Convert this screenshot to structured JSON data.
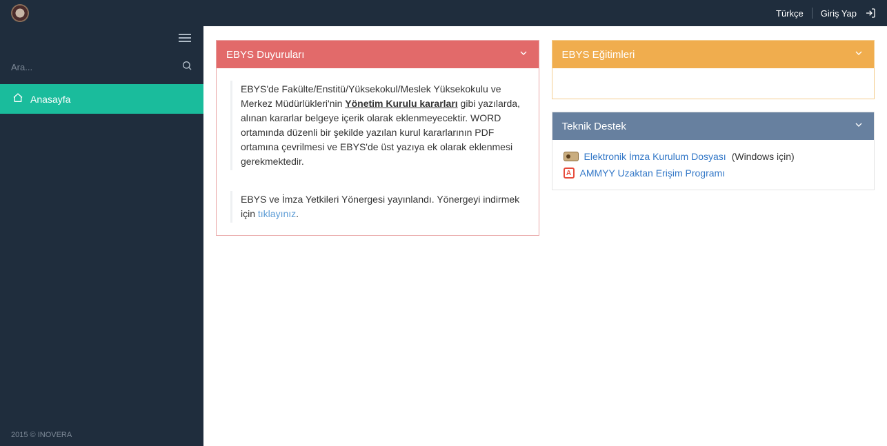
{
  "header": {
    "language": "Türkçe",
    "login": "Giriş Yap"
  },
  "sidebar": {
    "search_placeholder": "Ara...",
    "nav": {
      "home": "Anasayfa"
    },
    "footer": "2015 © INOVERA"
  },
  "panels": {
    "announcements": {
      "title": "EBYS Duyuruları",
      "items": [
        {
          "pre": "EBYS'de Fakülte/Enstitü/Yüksekokul/Meslek Yüksekokulu ve Merkez Müdürlükleri'nin ",
          "underline": "Yönetim Kurulu kararları",
          "post": " gibi yazılarda, alınan kararlar belgeye içerik olarak eklenmeyecektir. WORD ortamında düzenli bir şekilde yazılan kurul kararlarının PDF ortamına çevrilmesi ve EBYS'de üst yazıya ek olarak eklenmesi gerekmektedir."
        },
        {
          "pre": "EBYS ve İmza Yetkileri Yönergesi yayınlandı. Yönergeyi indirmek için ",
          "link": "tıklayınız",
          "post": "."
        }
      ]
    },
    "trainings": {
      "title": "EBYS Eğitimleri"
    },
    "support": {
      "title": "Teknik Destek",
      "items": [
        {
          "icon": "key",
          "label": "Elektronik İmza Kurulum Dosyası",
          "suffix": " (Windows için)"
        },
        {
          "icon": "ammyy",
          "label": "AMMYY Uzaktan Erişim Programı",
          "suffix": ""
        }
      ]
    }
  }
}
